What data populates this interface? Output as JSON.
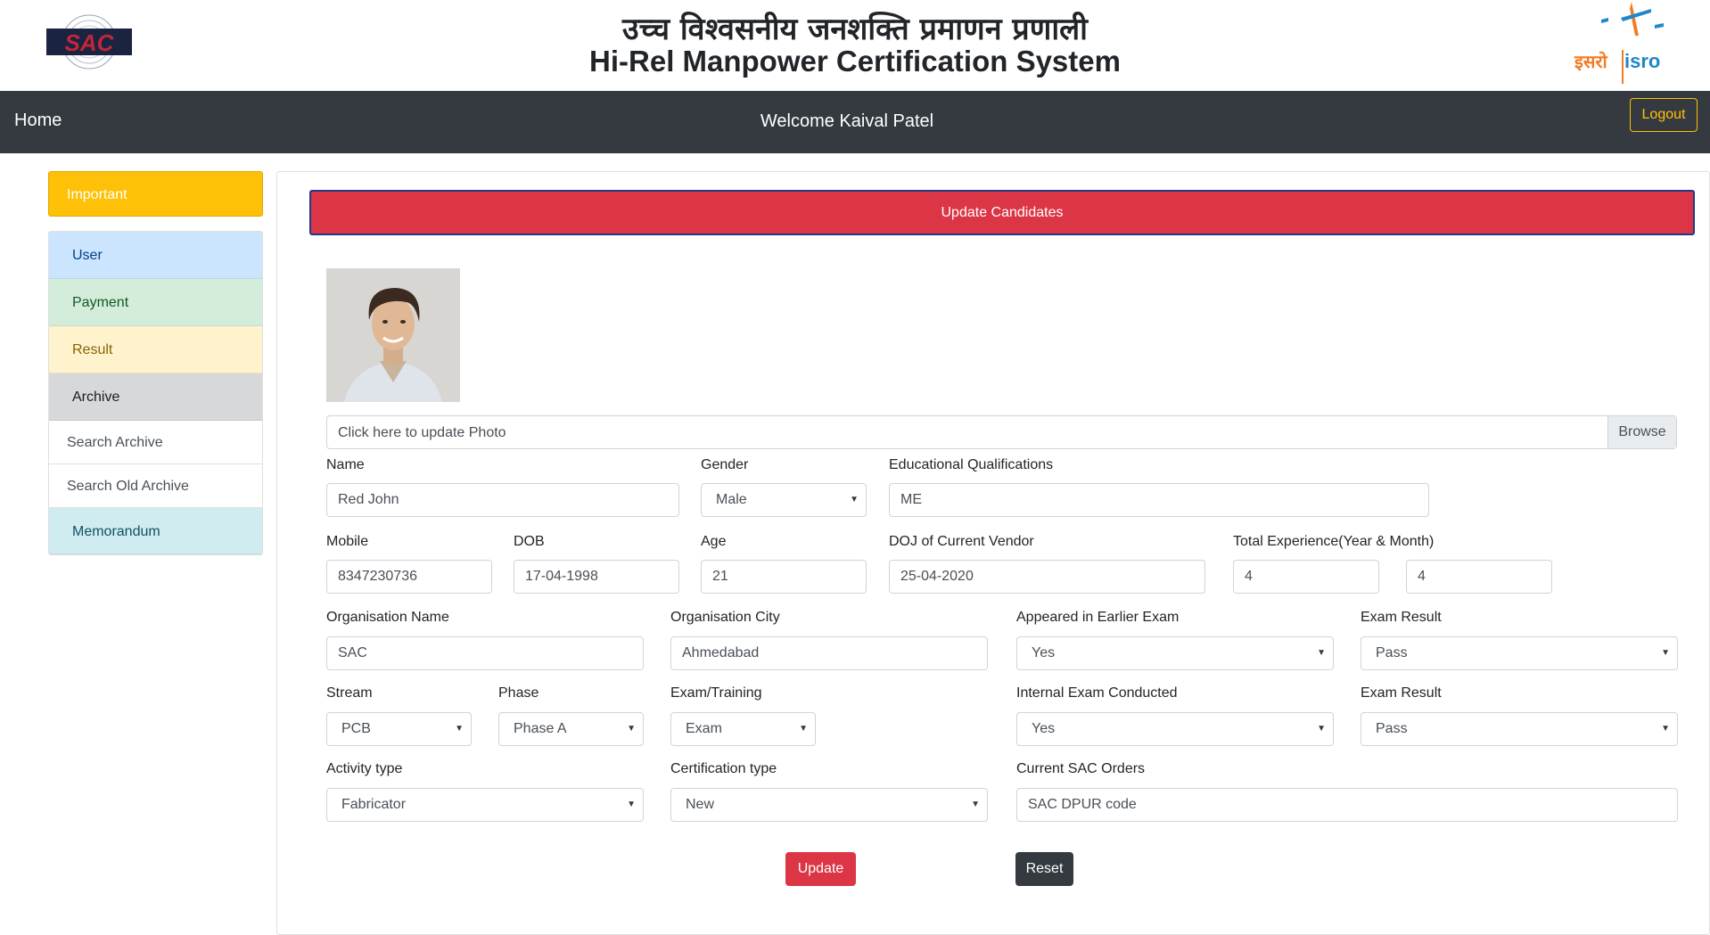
{
  "header": {
    "title_hindi": "उच्च विश्वसनीय जनशक्ति प्रमाणन प्रणाली",
    "title_english": "Hi-Rel Manpower Certification System",
    "left_logo_text": "SAC",
    "right_logo_text_hi": "इसरो",
    "right_logo_text_en": "isro"
  },
  "navbar": {
    "home_label": "Home",
    "welcome_text": "Welcome Kaival Patel",
    "logout_label": "Logout"
  },
  "sidebar": {
    "important_label": "Important",
    "items": [
      {
        "label": "User"
      },
      {
        "label": "Payment"
      },
      {
        "label": "Result"
      },
      {
        "label": "Archive"
      }
    ],
    "archive_sub": [
      {
        "label": "Search Archive"
      },
      {
        "label": "Search Old Archive"
      }
    ],
    "memorandum_label": "Memorandum"
  },
  "main": {
    "banner": "Update Candidates",
    "photo_input": {
      "label": "Click here to update Photo",
      "browse": "Browse"
    },
    "fields": {
      "name": {
        "label": "Name",
        "value": "Red John"
      },
      "gender": {
        "label": "Gender",
        "value": "Male"
      },
      "edu": {
        "label": "Educational Qualifications",
        "value": "ME"
      },
      "mobile": {
        "label": "Mobile",
        "value": "8347230736"
      },
      "dob": {
        "label": "DOB",
        "value": "17-04-1998"
      },
      "age": {
        "label": "Age",
        "value": "21"
      },
      "doj": {
        "label": "DOJ of Current Vendor",
        "value": "25-04-2020"
      },
      "experience": {
        "label": "Total Experience(Year & Month)",
        "years": "4",
        "months": "4"
      },
      "org_name": {
        "label": "Organisation Name",
        "value": "SAC"
      },
      "org_city": {
        "label": "Organisation City",
        "value": "Ahmedabad"
      },
      "earlier_exam": {
        "label": "Appeared in Earlier Exam",
        "value": "Yes"
      },
      "exam_result_1": {
        "label": "Exam Result",
        "value": "Pass"
      },
      "stream": {
        "label": "Stream",
        "value": "PCB"
      },
      "phase": {
        "label": "Phase",
        "value": "Phase A"
      },
      "exam_training": {
        "label": "Exam/Training",
        "value": "Exam"
      },
      "internal_exam": {
        "label": "Internal Exam Conducted",
        "value": "Yes"
      },
      "exam_result_2": {
        "label": "Exam Result",
        "value": "Pass"
      },
      "activity": {
        "label": "Activity type",
        "value": "Fabricator"
      },
      "cert_type": {
        "label": "Certification type",
        "value": "New"
      },
      "sac_orders": {
        "label": "Current SAC Orders",
        "value": "SAC DPUR code"
      }
    },
    "update_label": "Update",
    "reset_label": "Reset"
  },
  "colors": {
    "navbar": "#343a40",
    "banner": "#dc3545",
    "important": "#ffc107"
  }
}
